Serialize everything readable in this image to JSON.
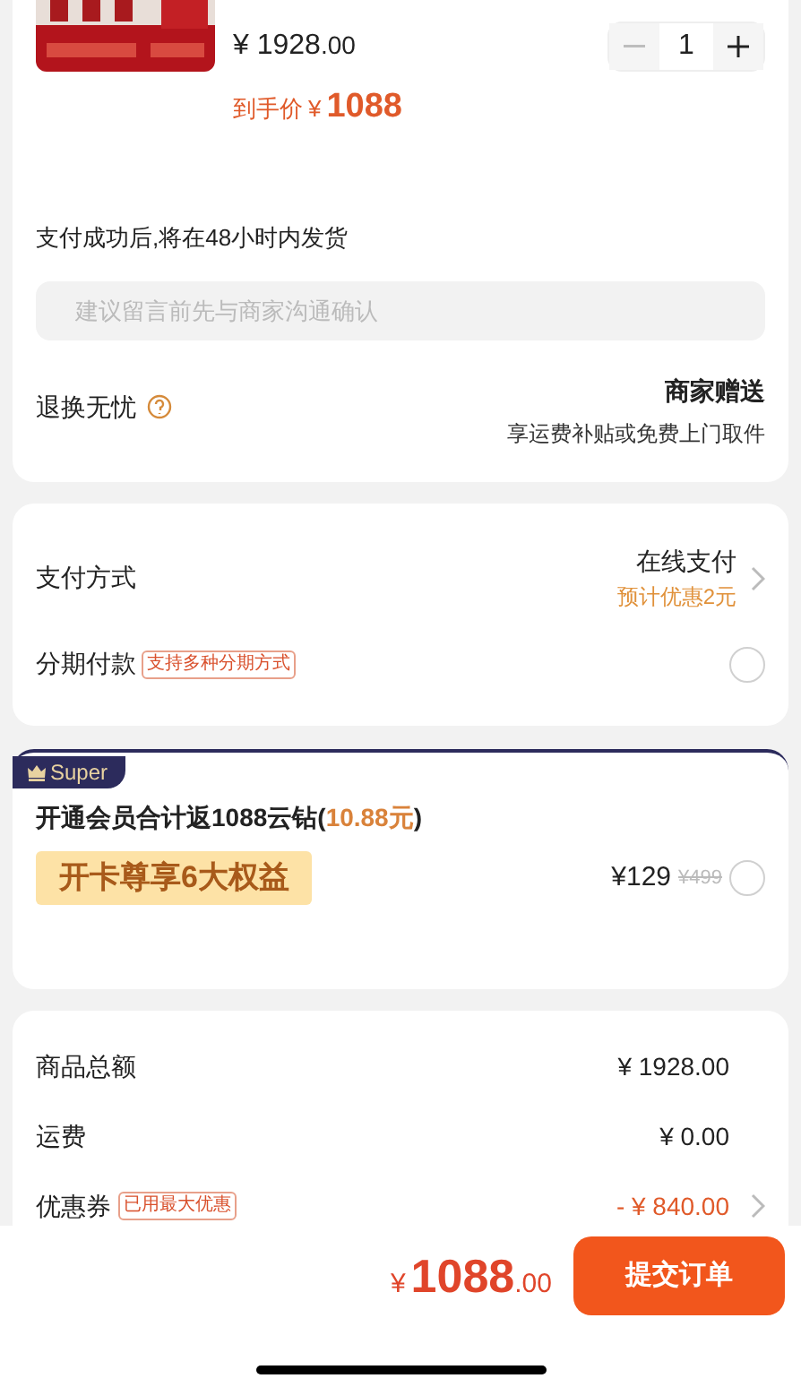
{
  "product": {
    "price_symbol": "¥",
    "price": "1928",
    "price_decimals": ".00",
    "quantity": "1",
    "minus_disabled": true,
    "final_label": "到手价",
    "final_symbol": "¥",
    "final_price": "1088"
  },
  "shipping_note": "支付成功后,将在48小时内发货",
  "message_field": {
    "placeholder": "建议留言前先与商家沟通确认"
  },
  "returns": {
    "label": "退换无忧",
    "title": "商家赠送",
    "subtitle": "享运费补贴或免费上门取件"
  },
  "payment": {
    "label": "支付方式",
    "method": "在线支付",
    "discount": "预计优惠2元"
  },
  "installment": {
    "label": "分期付款",
    "tag": "支持多种分期方式",
    "selected": false
  },
  "membership": {
    "badge": "Super",
    "text": "开通会员合计返1088云钻(",
    "highlight": "10.88元",
    "text_end": ")",
    "banner": "开卡尊享6大权益",
    "price": "¥129",
    "old_price": "¥499",
    "selected": false
  },
  "summary": [
    {
      "label": "商品总额",
      "value": "¥ 1928.00",
      "kind": "plain"
    },
    {
      "label": "运费",
      "value": "¥ 0.00",
      "kind": "plain"
    },
    {
      "label": "优惠券",
      "tag": "已用最大优惠",
      "value": "- ¥ 840.00",
      "kind": "discount"
    }
  ],
  "footer": {
    "symbol": "¥",
    "total": "1088",
    "decimals": ".00",
    "button": "提交订单"
  }
}
